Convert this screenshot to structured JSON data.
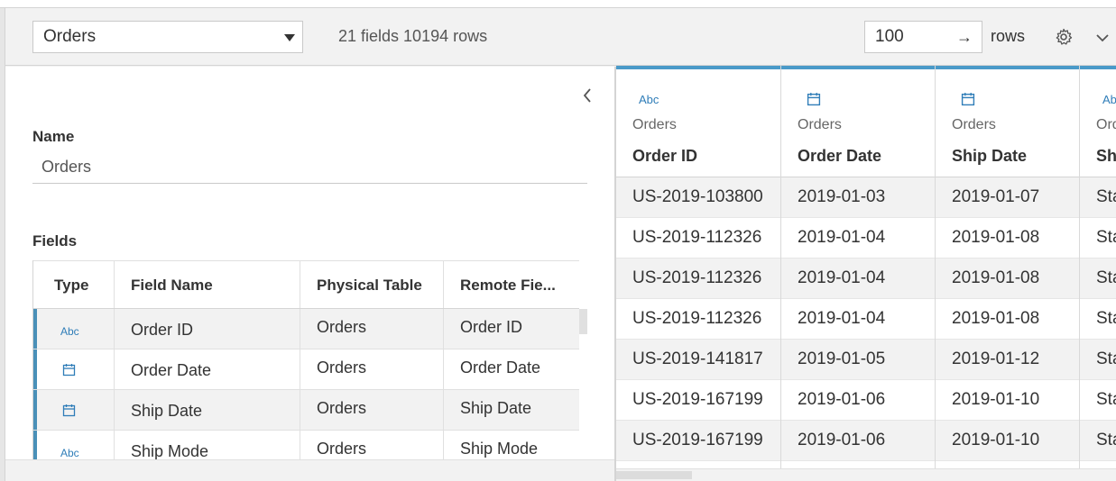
{
  "toolbar": {
    "table_select": "Orders",
    "summary": "21 fields 10194 rows",
    "rows_value": "100",
    "rows_arrow": "→",
    "rows_label": "rows"
  },
  "left_panel": {
    "name_label": "Name",
    "name_value": "Orders",
    "fields_label": "Fields",
    "columns": [
      "Type",
      "Field Name",
      "Physical Table",
      "Remote Fie..."
    ],
    "fields": [
      {
        "type": "Abc",
        "name": "Order ID",
        "table": "Orders",
        "remote": "Order ID"
      },
      {
        "type": "date",
        "name": "Order Date",
        "table": "Orders",
        "remote": "Order Date"
      },
      {
        "type": "date",
        "name": "Ship Date",
        "table": "Orders",
        "remote": "Ship Date"
      },
      {
        "type": "Abc",
        "name": "Ship Mode",
        "table": "Orders",
        "remote": "Ship Mode"
      }
    ]
  },
  "grid": {
    "columns": [
      {
        "type": "Abc",
        "source": "Orders",
        "name": "Order ID"
      },
      {
        "type": "date",
        "source": "Orders",
        "name": "Order Date"
      },
      {
        "type": "date",
        "source": "Orders",
        "name": "Ship Date"
      },
      {
        "type": "Abc",
        "source": "Orders",
        "name": "Ship Mode"
      }
    ],
    "rows": [
      [
        "US-2019-103800",
        "2019-01-03",
        "2019-01-07",
        "Standard Class"
      ],
      [
        "US-2019-112326",
        "2019-01-04",
        "2019-01-08",
        "Standard Class"
      ],
      [
        "US-2019-112326",
        "2019-01-04",
        "2019-01-08",
        "Standard Class"
      ],
      [
        "US-2019-112326",
        "2019-01-04",
        "2019-01-08",
        "Standard Class"
      ],
      [
        "US-2019-141817",
        "2019-01-05",
        "2019-01-12",
        "Standard Class"
      ],
      [
        "US-2019-167199",
        "2019-01-06",
        "2019-01-10",
        "Standard Class"
      ],
      [
        "US-2019-167199",
        "2019-01-06",
        "2019-01-10",
        "Standard Class"
      ],
      [
        "",
        "",
        "",
        ""
      ]
    ]
  },
  "icons": {
    "abc": "Abc",
    "date": "calendar-icon",
    "settings": "gear-icon",
    "expand": "chevron-down-icon",
    "collapse": "chevron-left-icon"
  },
  "colors": {
    "accent": "#4a9ac9",
    "type_icon": "#2f7db8"
  }
}
